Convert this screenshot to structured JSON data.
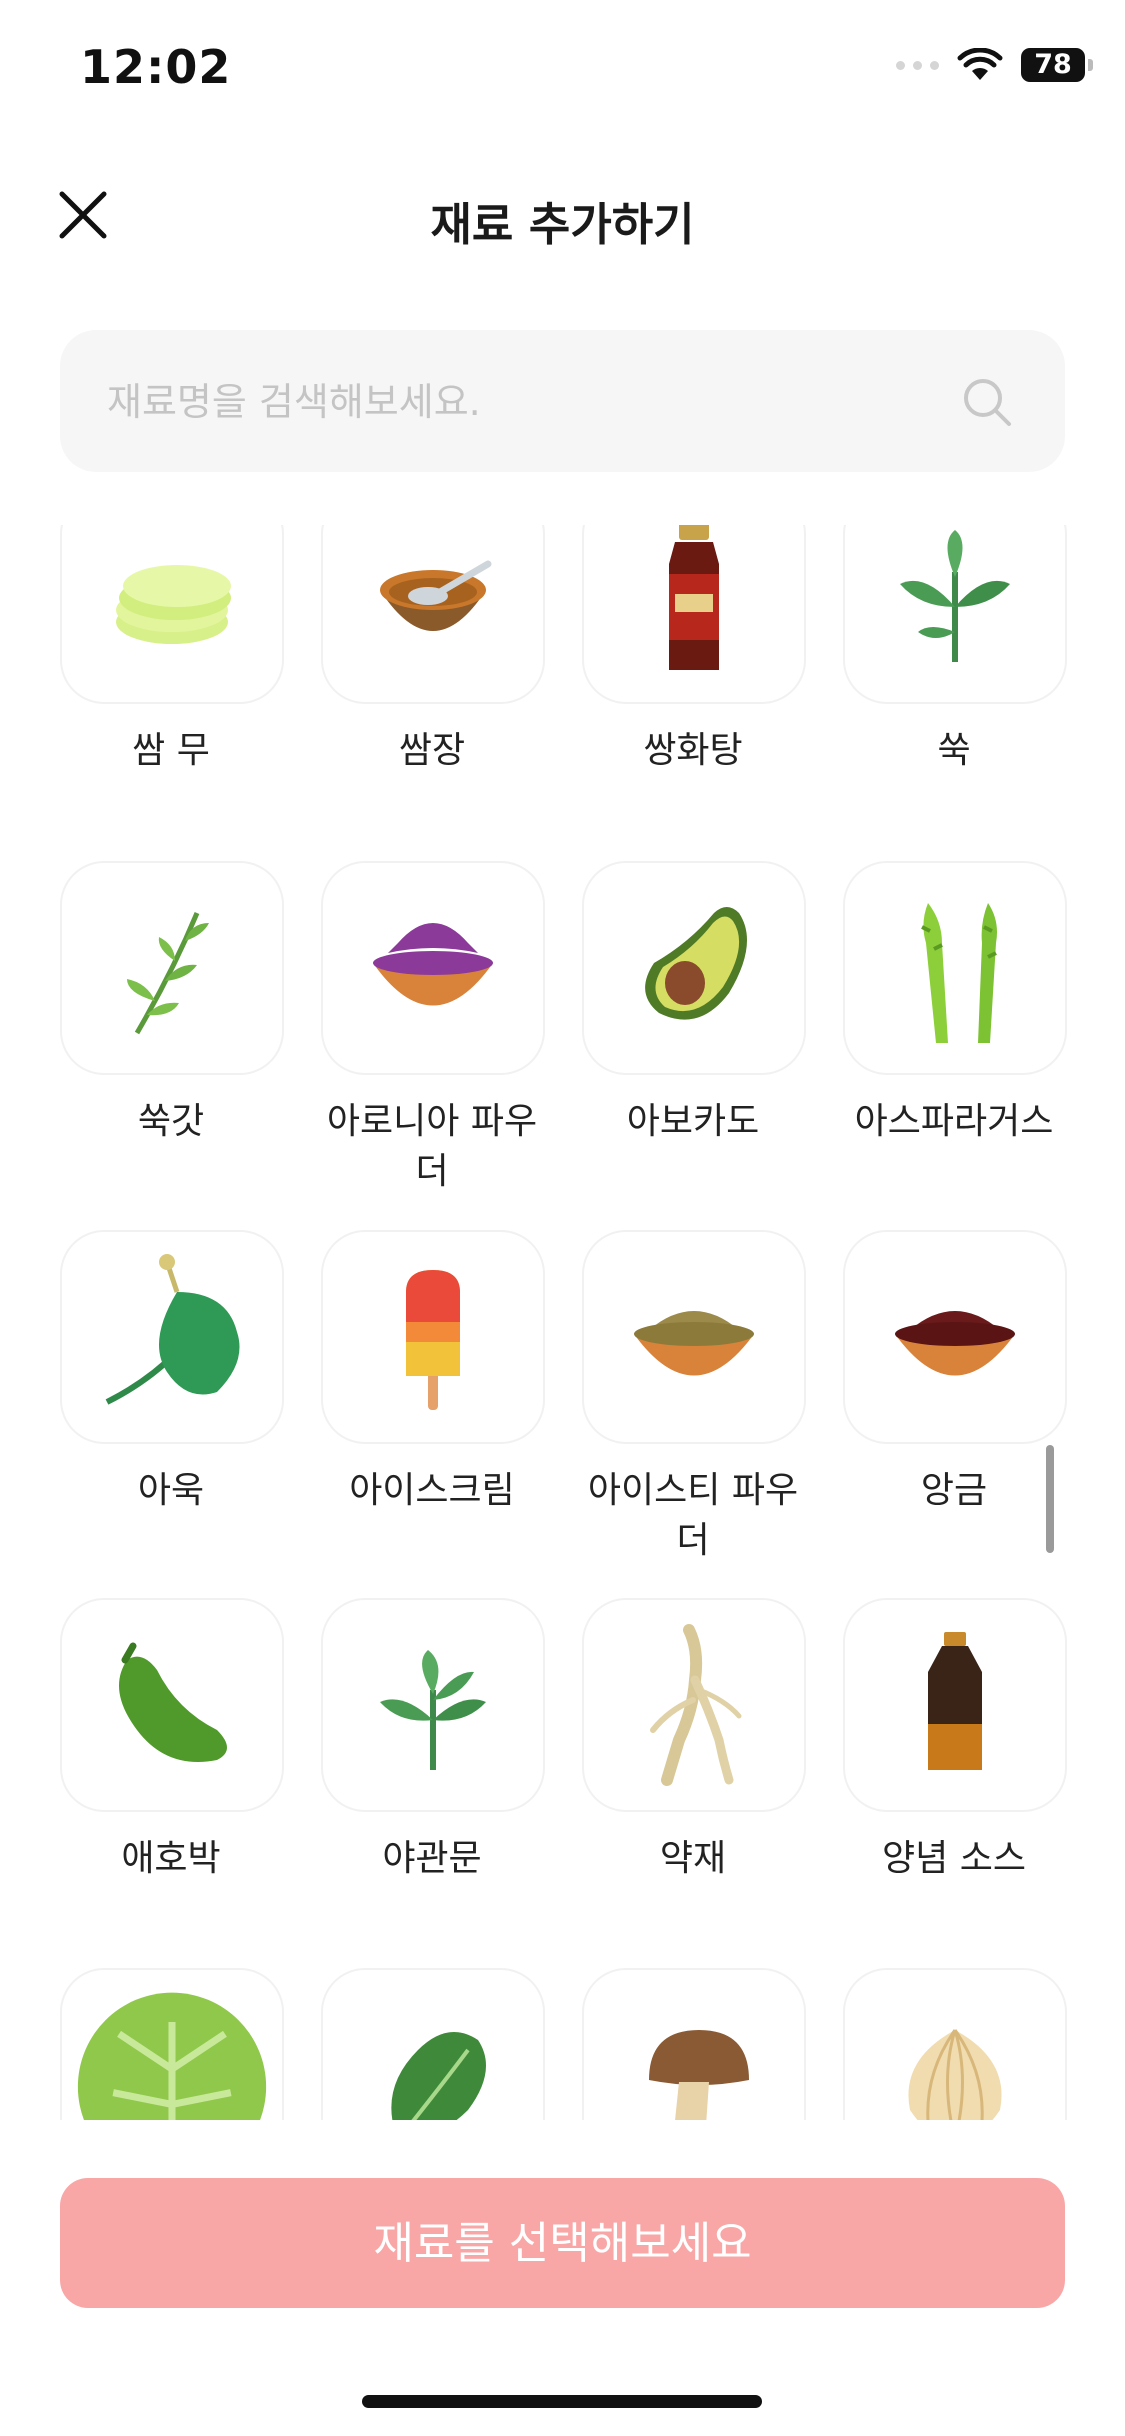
{
  "status_bar": {
    "time": "12:02",
    "battery": "78"
  },
  "header": {
    "title": "재료 추가하기"
  },
  "search": {
    "placeholder": "재료명을 검색해보세요."
  },
  "ingredients": [
    {
      "label": "쌈 무",
      "icon": "pickled-radish-icon"
    },
    {
      "label": "쌈장",
      "icon": "ssamjang-bowl-icon"
    },
    {
      "label": "쌍화탕",
      "icon": "herbal-drink-bottle-icon"
    },
    {
      "label": "쑥",
      "icon": "mugwort-icon"
    },
    {
      "label": "쑥갓",
      "icon": "crown-daisy-icon"
    },
    {
      "label": "아로니아 파우더",
      "icon": "aronia-powder-icon"
    },
    {
      "label": "아보카도",
      "icon": "avocado-icon"
    },
    {
      "label": "아스파라거스",
      "icon": "asparagus-icon"
    },
    {
      "label": "아욱",
      "icon": "mallow-icon"
    },
    {
      "label": "아이스크림",
      "icon": "ice-pop-icon"
    },
    {
      "label": "아이스티 파우더",
      "icon": "iced-tea-powder-icon"
    },
    {
      "label": "앙금",
      "icon": "red-bean-paste-icon"
    },
    {
      "label": "애호박",
      "icon": "zucchini-icon"
    },
    {
      "label": "야관문",
      "icon": "herb-sprig-icon"
    },
    {
      "label": "약재",
      "icon": "ginseng-root-icon"
    },
    {
      "label": "양념 소스",
      "icon": "sauce-bottle-icon"
    },
    {
      "label": "",
      "icon": "cabbage-icon"
    },
    {
      "label": "",
      "icon": "lettuce-icon"
    },
    {
      "label": "",
      "icon": "mushroom-icon"
    },
    {
      "label": "",
      "icon": "onion-icon"
    }
  ],
  "cta": {
    "label": "재료를 선택해보세요"
  },
  "colors": {
    "cta_background": "#f9a6a6",
    "card_border": "#f1f1f1",
    "search_background": "#f6f6f6"
  }
}
